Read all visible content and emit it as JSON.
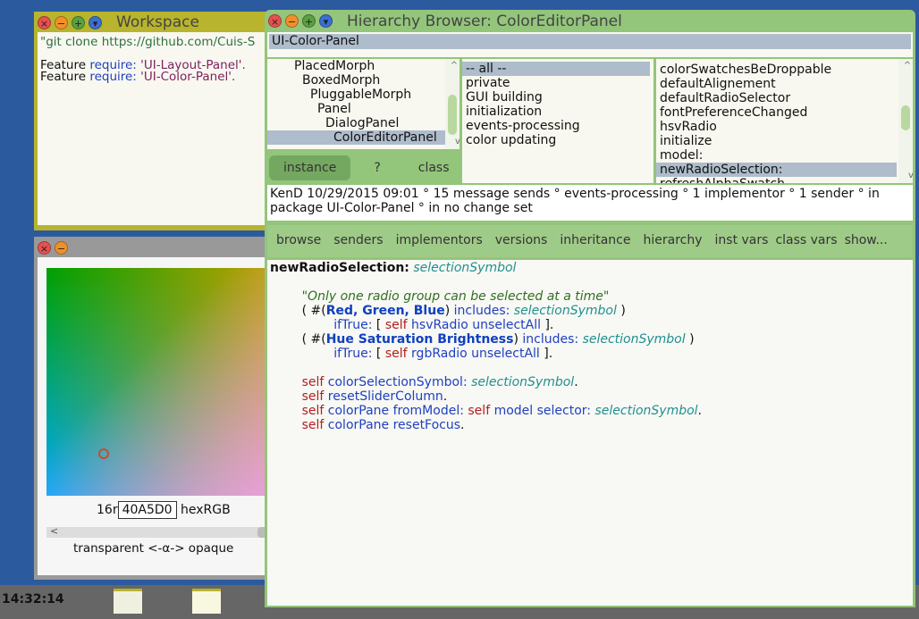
{
  "workspace": {
    "title": "Workspace",
    "lines": [
      "\"git clone https://github.com/Cuis-S"
    ],
    "f1": "Feature",
    "req": "require:",
    "s1": "'UI-Layout-Panel'.",
    "s2": "'UI-Color-Panel'."
  },
  "color_editor": {
    "prefix": "16r",
    "hex": "40A5D0",
    "suffix": "hexRGB",
    "alpha_label": "transparent <-α-> opaque"
  },
  "taskbar": {
    "clock": "14:32:14"
  },
  "browser": {
    "title": "Hierarchy Browser: ColorEditorPanel",
    "package": "UI-Color-Panel",
    "classes": [
      "PlacedMorph",
      "BoxedMorph",
      "PluggableMorph",
      "Panel",
      "DialogPanel",
      "ColorEditorPanel"
    ],
    "categories": [
      "-- all --",
      "private",
      "GUI building",
      "initialization",
      "events-processing",
      "color updating"
    ],
    "methods": [
      "colorSwatchesBeDroppable",
      "defaultAlignement",
      "defaultRadioSelector",
      "fontPreferenceChanged",
      "hsvRadio",
      "initialize",
      "model:",
      "newRadioSelection:",
      "refreshAlphaSwatch"
    ],
    "toggles": {
      "instance": "instance",
      "help": "?",
      "class": "class"
    },
    "info_1": "KenD 10/29/2015 09:01 ° 15 message sends ° events-processing ° 1 implementor ° 1 sender ° in",
    "info_2": "package UI-Color-Panel ° in no change set",
    "buttons": [
      "browse",
      "senders",
      "implementors",
      "versions",
      "inheritance",
      "hierarchy",
      "inst vars",
      "class vars",
      "show..."
    ],
    "code": {
      "sel": "newRadioSelection:",
      "arg": "selectionSymbol",
      "comment": "\"Only one radio group can be selected at a time\"",
      "sym1": "Red, Green, Blue",
      "sym2": "Hue Saturation Brightness",
      "includes": "includes:",
      "iftrue": "ifTrue:",
      "self": "self",
      "hsv": "hsvRadio unselectAll",
      "rgb": "rgbRadio unselectAll",
      "cs": "colorSelectionSymbol:",
      "rsc": "resetSliderColumn",
      "cp": "colorPane fromModel:",
      "ms": "model selector:",
      "rf": "colorPane resetFocus"
    }
  }
}
